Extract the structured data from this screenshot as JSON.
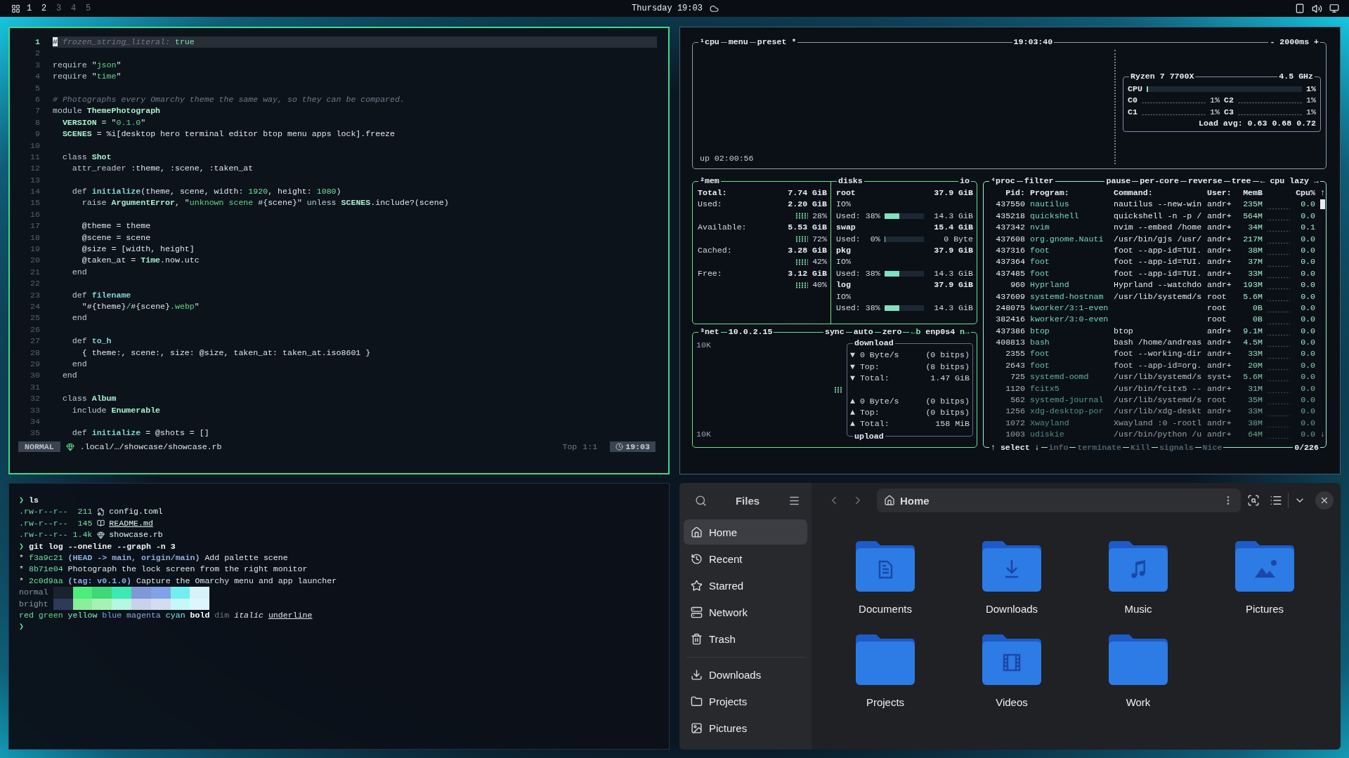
{
  "topbar": {
    "workspaces": [
      {
        "label": "1",
        "occupied": true
      },
      {
        "label": "2",
        "occupied": true
      },
      {
        "label": "3",
        "occupied": false
      },
      {
        "label": "4",
        "occupied": false
      },
      {
        "label": "5",
        "occupied": false
      }
    ],
    "clock": "Thursday 19:03"
  },
  "editor": {
    "lines": [
      {
        "number": "1",
        "current": true,
        "tokens": [
          {
            "kind": "cursor",
            "text": "#"
          },
          {
            "kind": "comment",
            "text": " frozen_string_literal: "
          },
          {
            "kind": "const",
            "text": "true"
          }
        ]
      },
      {
        "number": "2",
        "current": false
      },
      {
        "number": "3",
        "current": false,
        "tokens": [
          {
            "kind": "kw",
            "text": "require"
          },
          {
            "kind": "plain",
            "text": " \""
          },
          {
            "kind": "str",
            "text": "json"
          },
          {
            "kind": "plain",
            "text": "\""
          }
        ]
      },
      {
        "number": "4",
        "current": false,
        "tokens": [
          {
            "kind": "kw",
            "text": "require"
          },
          {
            "kind": "plain",
            "text": " \""
          },
          {
            "kind": "str",
            "text": "time"
          },
          {
            "kind": "plain",
            "text": "\""
          }
        ]
      },
      {
        "number": "5",
        "current": false
      },
      {
        "number": "6",
        "current": false,
        "tokens": [
          {
            "kind": "comment",
            "text": "# Photographs every Omarchy theme the same way, so they can be compared."
          }
        ]
      },
      {
        "number": "7",
        "current": false,
        "tokens": [
          {
            "kind": "kw",
            "text": "module "
          },
          {
            "kind": "type",
            "text": "ThemePhotograph"
          }
        ]
      },
      {
        "number": "8",
        "current": false,
        "tokens": [
          {
            "kind": "type",
            "text": "  VERSION"
          },
          {
            "kind": "plain",
            "text": " = \""
          },
          {
            "kind": "str",
            "text": "0.1.0"
          },
          {
            "kind": "plain",
            "text": "\""
          }
        ]
      },
      {
        "number": "9",
        "current": false,
        "tokens": [
          {
            "kind": "type",
            "text": "  SCENES"
          },
          {
            "kind": "plain",
            "text": " = %i[desktop hero terminal editor btop menu apps lock].freeze"
          }
        ]
      },
      {
        "number": "10",
        "current": false
      },
      {
        "number": "11",
        "current": false,
        "tokens": [
          {
            "kind": "kw",
            "text": "  class "
          },
          {
            "kind": "type",
            "text": "Shot"
          }
        ]
      },
      {
        "number": "12",
        "current": false,
        "tokens": [
          {
            "kind": "kw",
            "text": "    attr_reader"
          },
          {
            "kind": "plain",
            "text": " :theme, :scene, :taken_at"
          }
        ]
      },
      {
        "number": "13",
        "current": false
      },
      {
        "number": "14",
        "current": false,
        "tokens": [
          {
            "kind": "kw",
            "text": "    def "
          },
          {
            "kind": "fn",
            "text": "initialize"
          },
          {
            "kind": "plain",
            "text": "(theme, scene, width: "
          },
          {
            "kind": "num",
            "text": "1920"
          },
          {
            "kind": "plain",
            "text": ", height: "
          },
          {
            "kind": "num",
            "text": "1080"
          },
          {
            "kind": "plain",
            "text": ")"
          }
        ]
      },
      {
        "number": "15",
        "current": false,
        "tokens": [
          {
            "kind": "kw",
            "text": "      raise "
          },
          {
            "kind": "type",
            "text": "ArgumentError"
          },
          {
            "kind": "plain",
            "text": ", \""
          },
          {
            "kind": "str",
            "text": "unknown scene "
          },
          {
            "kind": "plain",
            "text": "#{scene}\" "
          },
          {
            "kind": "kw",
            "text": "unless "
          },
          {
            "kind": "type",
            "text": "SCENES"
          },
          {
            "kind": "plain",
            "text": ".include?(scene)"
          }
        ]
      },
      {
        "number": "16",
        "current": false
      },
      {
        "number": "17",
        "current": false,
        "tokens": [
          {
            "kind": "plain",
            "text": "      @theme = theme"
          }
        ]
      },
      {
        "number": "18",
        "current": false,
        "tokens": [
          {
            "kind": "plain",
            "text": "      @scene = scene"
          }
        ]
      },
      {
        "number": "19",
        "current": false,
        "tokens": [
          {
            "kind": "plain",
            "text": "      @size = [width, height]"
          }
        ]
      },
      {
        "number": "20",
        "current": false,
        "tokens": [
          {
            "kind": "plain",
            "text": "      @taken_at = "
          },
          {
            "kind": "type",
            "text": "Time"
          },
          {
            "kind": "plain",
            "text": ".now.utc"
          }
        ]
      },
      {
        "number": "21",
        "current": false,
        "tokens": [
          {
            "kind": "kw",
            "text": "    end"
          }
        ]
      },
      {
        "number": "22",
        "current": false
      },
      {
        "number": "23",
        "current": false,
        "tokens": [
          {
            "kind": "kw",
            "text": "    def "
          },
          {
            "kind": "fn",
            "text": "filename"
          }
        ]
      },
      {
        "number": "24",
        "current": false,
        "tokens": [
          {
            "kind": "plain",
            "text": "      \"#{theme}"
          },
          {
            "kind": "str",
            "text": "/"
          },
          {
            "kind": "plain",
            "text": "#{scene}"
          },
          {
            "kind": "str",
            "text": ".webp"
          },
          {
            "kind": "plain",
            "text": "\""
          }
        ]
      },
      {
        "number": "25",
        "current": false,
        "tokens": [
          {
            "kind": "kw",
            "text": "    end"
          }
        ]
      },
      {
        "number": "26",
        "current": false
      },
      {
        "number": "27",
        "current": false,
        "tokens": [
          {
            "kind": "kw",
            "text": "    def "
          },
          {
            "kind": "fn",
            "text": "to_h"
          }
        ]
      },
      {
        "number": "28",
        "current": false,
        "tokens": [
          {
            "kind": "plain",
            "text": "      { theme:, scene:, size: @size, taken_at: taken_at.iso8601 }"
          }
        ]
      },
      {
        "number": "29",
        "current": false,
        "tokens": [
          {
            "kind": "kw",
            "text": "    end"
          }
        ]
      },
      {
        "number": "30",
        "current": false,
        "tokens": [
          {
            "kind": "kw",
            "text": "  end"
          }
        ]
      },
      {
        "number": "31",
        "current": false
      },
      {
        "number": "32",
        "current": false,
        "tokens": [
          {
            "kind": "kw",
            "text": "  class "
          },
          {
            "kind": "type",
            "text": "Album"
          }
        ]
      },
      {
        "number": "33",
        "current": false,
        "tokens": [
          {
            "kind": "kw",
            "text": "    include "
          },
          {
            "kind": "type",
            "text": "Enumerable"
          }
        ]
      },
      {
        "number": "34",
        "current": false
      },
      {
        "number": "35",
        "current": false,
        "tokens": [
          {
            "kind": "kw",
            "text": "    def "
          },
          {
            "kind": "fn",
            "text": "initialize"
          },
          {
            "kind": "plain",
            "text": " = @shots = []"
          }
        ]
      }
    ],
    "status": {
      "mode": "NORMAL",
      "file": ".local/…/showcase/showcase.rb",
      "position": "Top",
      "cursor": "1:1",
      "time": "19:03"
    }
  },
  "btop": {
    "cpu": {
      "name": "¹cpu",
      "options": [
        "menu",
        "preset *"
      ],
      "clock": "19:03:40",
      "interval": "- 2000ms +",
      "uptime": "up 02:00:56",
      "model": "Ryzen 7 7700X",
      "frequency": "4.5 GHz",
      "total": {
        "label": "CPU",
        "value": "1%",
        "level": 0.01
      },
      "cores": [
        {
          "label": "C0",
          "value": "1%"
        },
        {
          "label": "C2",
          "value": "1%"
        },
        {
          "label": "C1",
          "value": "1%"
        },
        {
          "label": "C3",
          "value": "1%"
        }
      ],
      "load": "Load avg: 0.63 0.68 0.72"
    },
    "mem": {
      "name": "²mem",
      "rows": [
        {
          "label": "Total:",
          "value": "7.74 GiB"
        },
        {
          "label": "Used:",
          "value": "2.20 GiB",
          "percent": "28%"
        },
        {
          "label": "Available:",
          "value": "5.53 GiB",
          "percent": "72%"
        },
        {
          "label": "Cached:",
          "value": "3.28 GiB",
          "percent": "42%"
        },
        {
          "label": "Free:",
          "value": "3.12 GiB",
          "percent": "40%"
        }
      ]
    },
    "disks": {
      "name": "disks",
      "mode": "io",
      "items": [
        {
          "name": "root",
          "size": "37.9 GiB",
          "io": "IO%",
          "used": "Used: 38%",
          "level": 0.38,
          "amount": "14.3 GiB"
        },
        {
          "name": "swap",
          "size": "15.4 GiB",
          "used": "Used:  0%",
          "level": 0,
          "amount": "0 Byte"
        },
        {
          "name": "pkg",
          "size": "37.9 GiB",
          "io": "IO%",
          "used": "Used: 38%",
          "level": 0.38,
          "amount": "14.3 GiB"
        },
        {
          "name": "log",
          "size": "37.9 GiB",
          "io": "IO%",
          "used": "Used: 38%",
          "level": 0.38,
          "amount": "14.3 GiB"
        }
      ]
    },
    "net": {
      "name": "³net",
      "address": "10.0.2.15",
      "options": [
        "sync",
        "auto",
        "zero"
      ],
      "interface": {
        "prev": "←b",
        "name": "enp0s4",
        "next": "n→"
      },
      "scale_top": "10K",
      "scale_bottom": "10K",
      "download": {
        "title": "download",
        "rows": [
          {
            "label": "▼ 0 Byte/s",
            "value": "(0 bitps)"
          },
          {
            "label": "▼ Top:",
            "value": "(8 bitps)"
          },
          {
            "label": "▼ Total:",
            "value": "1.47 GiB"
          }
        ]
      },
      "upload": {
        "title": "upload",
        "rows": [
          {
            "label": "▲ 0 Byte/s",
            "value": "(0 bitps)"
          },
          {
            "label": "▲ Top:",
            "value": "(0 bitps)"
          },
          {
            "label": "▲ Total:",
            "value": "158 MiB"
          }
        ]
      }
    },
    "proc": {
      "name": "⁴proc",
      "filter": "filter",
      "options": [
        "pause",
        "per-core",
        "reverse",
        "tree"
      ],
      "sort": "← cpu lazy →",
      "columns": [
        "Pid:",
        "Program:",
        "Command:",
        "User:",
        "MemB",
        "Cpu%"
      ],
      "scroll_up": "↑",
      "scroll_down": "↓",
      "rows": [
        {
          "pid": "437550",
          "program": "nautilus",
          "command": "nautilus --new-win",
          "user": "andr+",
          "mem": "235M",
          "cpu": "0.0"
        },
        {
          "pid": "435218",
          "program": "quickshell",
          "command": "quickshell -n -p /",
          "user": "andr+",
          "mem": "564M",
          "cpu": "0.0"
        },
        {
          "pid": "437342",
          "program": "nvim",
          "command": "nvim --embed /home",
          "user": "andr+",
          "mem": "34M",
          "cpu": "0.1"
        },
        {
          "pid": "437608",
          "program": "org.gnome.Nauti",
          "command": "/usr/bin/gjs /usr/",
          "user": "andr+",
          "mem": "217M",
          "cpu": "0.0"
        },
        {
          "pid": "437316",
          "program": "foot",
          "command": "foot --app-id=TUI.",
          "user": "andr+",
          "mem": "38M",
          "cpu": "0.0"
        },
        {
          "pid": "437364",
          "program": "foot",
          "command": "foot --app-id=TUI.",
          "user": "andr+",
          "mem": "37M",
          "cpu": "0.0"
        },
        {
          "pid": "437485",
          "program": "foot",
          "command": "foot --app-id=TUI.",
          "user": "andr+",
          "mem": "33M",
          "cpu": "0.0"
        },
        {
          "pid": "960",
          "program": "Hyprland",
          "command": "Hyprland --watchdo",
          "user": "andr+",
          "mem": "193M",
          "cpu": "0.0"
        },
        {
          "pid": "437609",
          "program": "systemd-hostnam",
          "command": "/usr/lib/systemd/s",
          "user": "root",
          "mem": "5.6M",
          "cpu": "0.0"
        },
        {
          "pid": "248075",
          "program": "kworker/3:1-even",
          "user": "root",
          "mem": "0B",
          "cpu": "0.0"
        },
        {
          "pid": "382416",
          "program": "kworker/3:0-even",
          "user": "root",
          "mem": "0B",
          "cpu": "0.0"
        },
        {
          "pid": "437386",
          "program": "btop",
          "command": "btop",
          "user": "andr+",
          "mem": "9.1M",
          "cpu": "0.0"
        },
        {
          "pid": "408813",
          "program": "bash",
          "command": "bash /home/andreas",
          "user": "andr+",
          "mem": "4.5M",
          "cpu": "0.0"
        },
        {
          "pid": "2355",
          "program": "foot",
          "command": "foot --working-dir",
          "user": "andr+",
          "mem": "33M",
          "cpu": "0.0"
        },
        {
          "pid": "2643",
          "program": "foot",
          "command": "foot --app-id=org.",
          "user": "andr+",
          "mem": "20M",
          "cpu": "0.0"
        },
        {
          "pid": "725",
          "program": "systemd-oomd",
          "command": "/usr/lib/systemd/s",
          "user": "syst+",
          "mem": "5.6M",
          "cpu": "0.0"
        },
        {
          "pid": "1120",
          "program": "fcitx5",
          "command": "/usr/bin/fcitx5 --",
          "user": "andr+",
          "mem": "31M",
          "cpu": "0.0"
        },
        {
          "pid": "562",
          "program": "systemd-journal",
          "command": "/usr/lib/systemd/s",
          "user": "root",
          "mem": "35M",
          "cpu": "0.0"
        },
        {
          "pid": "1256",
          "program": "xdg-desktop-por",
          "command": "/usr/lib/xdg-deskt",
          "user": "andr+",
          "mem": "33M",
          "cpu": "0.0"
        },
        {
          "pid": "1072",
          "program": "Xwayland",
          "command": "Xwayland :0 -rootl",
          "user": "andr+",
          "mem": "38M",
          "cpu": "0.0"
        },
        {
          "pid": "1003",
          "program": "udiskie",
          "command": "/usr/bin/python /u",
          "user": "andr+",
          "mem": "64M",
          "cpu": "0.0"
        }
      ],
      "footer": [
        {
          "label": "↑ select ↓",
          "disabled": false
        },
        {
          "label": "info",
          "disabled": true
        },
        {
          "label": "terminate",
          "disabled": true
        },
        {
          "label": "Kill",
          "disabled": true
        },
        {
          "label": "signals",
          "disabled": true
        },
        {
          "label": "Nice",
          "disabled": true
        }
      ],
      "count": "0/226"
    }
  },
  "terminal": {
    "lines": [
      {
        "kind": "prompt",
        "symbol": "❯",
        "command": "ls"
      },
      {
        "kind": "file",
        "perms": ".rw-r--r--",
        "size": "211",
        "name": "config.toml",
        "underline": false
      },
      {
        "kind": "file",
        "perms": ".rw-r--r--",
        "size": "145",
        "name": "README.md",
        "underline": true
      },
      {
        "kind": "file",
        "perms": ".rw-r--r--",
        "size": "1.4k",
        "name": "showcase.rb",
        "underline": false
      },
      {
        "kind": "prompt",
        "symbol": "❯",
        "command": "git log --oneline --graph -n 3"
      },
      {
        "kind": "text",
        "segments": [
          {
            "kind": "plain",
            "text": "* "
          },
          {
            "kind": "hash",
            "text": "f3a9c21"
          },
          {
            "kind": "ref",
            "text": " (HEAD -> main, origin/main)"
          },
          {
            "kind": "plain",
            "text": " Add palette scene"
          }
        ]
      },
      {
        "kind": "text",
        "segments": [
          {
            "kind": "plain",
            "text": "* "
          },
          {
            "kind": "hash",
            "text": "8b71e04"
          },
          {
            "kind": "plain",
            "text": " Photograph the lock screen from the right monitor"
          }
        ]
      },
      {
        "kind": "text",
        "segments": [
          {
            "kind": "plain",
            "text": "* "
          },
          {
            "kind": "hash",
            "text": "2c0d9aa"
          },
          {
            "kind": "ref",
            "text": " (tag: v0.1.0)"
          },
          {
            "kind": "plain",
            "text": " Capture the Omarchy menu and app launcher"
          }
        ]
      },
      {
        "kind": "palette",
        "label": "normal",
        "swatches": [
          {
            "color": "#1a2230"
          },
          {
            "color": "#4ded7a"
          },
          {
            "color": "#3fd879"
          },
          {
            "color": "#3ee8b5"
          },
          {
            "color": "#7f98d8"
          },
          {
            "color": "#7fa3e8"
          },
          {
            "color": "#72eef0"
          },
          {
            "color": "#d6f3fa"
          }
        ]
      },
      {
        "kind": "palette",
        "label": "bright",
        "swatches": [
          {
            "color": "#2e3a58"
          },
          {
            "color": "#8aee9a"
          },
          {
            "color": "#a6f2b4"
          },
          {
            "color": "#b6f6e2"
          },
          {
            "color": "#c8d2ea"
          },
          {
            "color": "#d4dcf0"
          },
          {
            "color": "#c6f8fa"
          },
          {
            "color": "#dff5fc"
          }
        ]
      },
      {
        "kind": "text",
        "segments": [
          {
            "kind": "red",
            "text": "red "
          },
          {
            "kind": "green",
            "text": "green "
          },
          {
            "kind": "yellow",
            "text": "yellow "
          },
          {
            "kind": "blue",
            "text": "blue "
          },
          {
            "kind": "magenta",
            "text": "magenta "
          },
          {
            "kind": "cyan",
            "text": "cyan "
          },
          {
            "kind": "bold",
            "text": "bold"
          },
          {
            "kind": "dim",
            "text": " dim "
          },
          {
            "kind": "italic",
            "text": "italic "
          },
          {
            "kind": "underline",
            "text": "underline"
          }
        ]
      },
      {
        "kind": "prompt",
        "symbol": "❯"
      }
    ]
  },
  "files": {
    "title": "Files",
    "location": "Home",
    "places": [
      {
        "label": "Home",
        "selected": true
      },
      {
        "label": "Recent",
        "selected": false
      },
      {
        "label": "Starred",
        "selected": false
      },
      {
        "label": "Network",
        "selected": false
      },
      {
        "label": "Trash",
        "selected": false
      }
    ],
    "bookmarks": [
      {
        "label": "Downloads",
        "selected": false
      },
      {
        "label": "Projects",
        "selected": false
      },
      {
        "label": "Pictures",
        "selected": false
      }
    ],
    "folders": [
      {
        "name": "Documents",
        "kind": "document"
      },
      {
        "name": "Downloads",
        "kind": "download"
      },
      {
        "name": "Music",
        "kind": "music"
      },
      {
        "name": "Pictures",
        "kind": "picture"
      },
      {
        "name": "Projects",
        "kind": "plain"
      },
      {
        "name": "Videos",
        "kind": "video"
      },
      {
        "name": "Work",
        "kind": "plain"
      }
    ]
  }
}
